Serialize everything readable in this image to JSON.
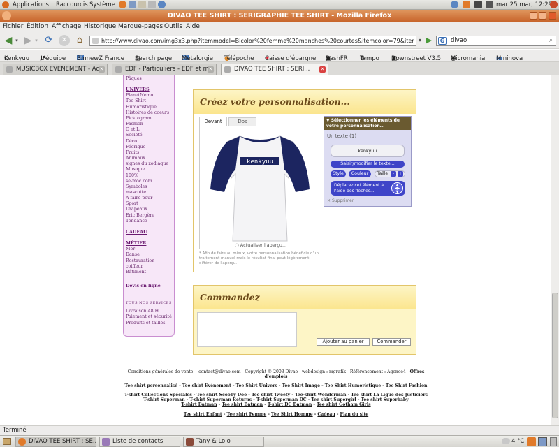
{
  "top_panel": {
    "menus": [
      "Applications",
      "Raccourcis",
      "Système"
    ],
    "clock": "mar 25 mar, 12:29"
  },
  "window": {
    "title": "DIVAO TEE SHIRT : SERIGRAPHIE TEE SHIRT - Mozilla Firefox"
  },
  "menubar": [
    "Fichier",
    "Édition",
    "Affichage",
    "Historique",
    "Marque-pages",
    "Outils",
    "Aide"
  ],
  "navigation": {
    "url": "http://www.divao.com/img3x3.php?itemmodel=Bicolor%20femme%20manches%20courtes&itemcolor=79&iter",
    "search_value": "divao"
  },
  "bookmarks": [
    "Kenkyuu",
    "L'équipe",
    "BinnewZ France",
    "Search page",
    "Metalorgie",
    "Télépoche",
    "Caisse d'épargne",
    "BashFR",
    "Tempo",
    "Downstreet V3.5",
    "Micromania",
    "Mininova"
  ],
  "tabs": [
    {
      "label": "MUSICBOX EVENEMENT - Ac...",
      "active": false
    },
    {
      "label": "EDF - Particuliers - EDF et m...",
      "active": false
    },
    {
      "label": "DIVAO TEE SHIRT : SERI...",
      "active": true
    }
  ],
  "sidebar": {
    "top_item": "Pâques",
    "univers_title": "UNIVERS",
    "univers_items": [
      "PlanetNemo",
      "Tee-Shirt",
      "Humoristique",
      "Histoires de coeurs",
      "Picktogram",
      "Fashion",
      "G et L",
      "Societé",
      "Déco",
      "Féerique",
      "Fruits",
      "Animaux",
      "signes du zodiaque",
      "Musique",
      "100%",
      "se-moc.com",
      "Symboles",
      "mascotte",
      "A faire peur",
      "Sport",
      "Drapeaux",
      "Eric Bergère",
      "Tendance"
    ],
    "cadeau": "CADEAU",
    "metier_title": "MÉTIER",
    "metier_items": [
      "Mer",
      "Danse",
      "Restauration",
      "coiffeur",
      "Bâtiment"
    ],
    "devis": "Devis en ligne",
    "services_title": "TOUS NOS SERVICES",
    "services_items": [
      "Livraison 48 H",
      "Paiement et sécurité",
      "Produits et tailles"
    ]
  },
  "custom": {
    "heading": "Créez votre personnalisation...",
    "tab_front": "Devant",
    "tab_back": "Dos",
    "shirt_text": "kenkyuu",
    "refresh_label": "Actualiser l'aperçu...",
    "note": "* Afin de faire au mieux, votre personnalisation bénéficie d'un traitement manuel mais le résultat final peut légèrement différer de l'aperçu.",
    "colors": {
      "shirt_body": "#f4f4f6",
      "sleeves": "#1c2560",
      "accent": "#3e44c8"
    }
  },
  "editor": {
    "header": "▼ Sélectionner les éléments de votre personnalisation...",
    "element_title": "Un texte (1)",
    "text_value": "kenkyuu",
    "edit_button": "Saisir/modifier le texte...",
    "style_button": "Style",
    "color_button": "Couleur",
    "size_label": "Taille",
    "size_minus": "-",
    "size_plus": "+",
    "move_hint": "Déplacez cet élément à l'aide des flèches...",
    "delete_label": "Supprimer"
  },
  "order": {
    "heading": "Commandez",
    "add_to_cart": "Ajouter au panier",
    "order_button": "Commander"
  },
  "footer": {
    "line1": [
      "Conditions générales de vente",
      "contact@divao.com",
      "Copyright © 2003",
      "Divao",
      "webdesign : mgrafik",
      "Référencement : Agence4",
      "Offres d'emplois"
    ],
    "line2": [
      "Tee shirt personnalisé",
      "Tee shirt Evénement",
      "Tee Shirt Univers",
      "Tee Shirt Image",
      "Tee Shirt Humoristique",
      "Tee Shirt Fashion"
    ],
    "line3": [
      "T-shirt Collections Spéciales",
      "Tee shirt Scooby Doo",
      "Tee shirt Tweety",
      "Tee-shirt Wonderman",
      "Tee shirt La Ligue des Justiciers"
    ],
    "line4": [
      "T-shirt Superman",
      "T-shirt Superman Returns",
      "T-shirt Superman DC",
      "Tee shirt Supergirl",
      "Tee shirt Superbaby"
    ],
    "line5": [
      "T-shirt Batman",
      "Tee shirt Batman",
      "T-shirt DC Batman",
      "Tee shirt Gotham Girls"
    ],
    "line6": [
      "Tee shirt Enfant",
      "Tee shirt Femme",
      "Tee Shirt Homme",
      "Cadeau",
      "Plan du site"
    ]
  },
  "status": "Terminé",
  "taskbar": {
    "tasks": [
      "DIVAO TEE SHIRT : SE...",
      "Liste de contacts",
      "Tany & Lolo"
    ],
    "weather": "4 °C"
  }
}
